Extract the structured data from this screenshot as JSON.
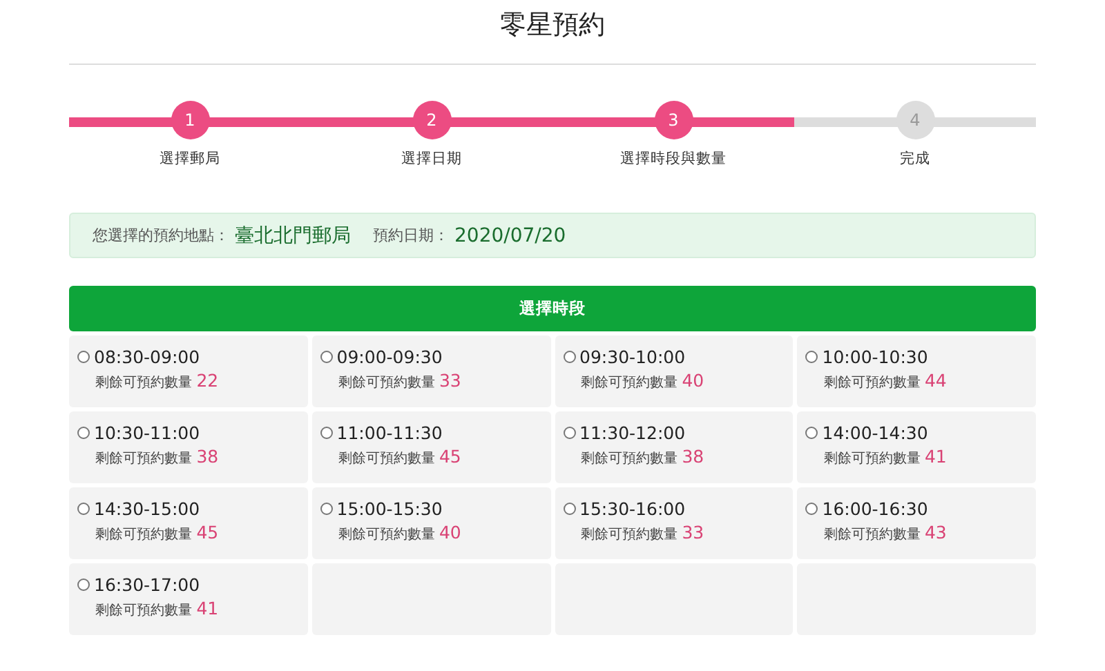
{
  "title": "零星預約",
  "steps": [
    {
      "number": "1",
      "label": "選擇郵局",
      "done": true
    },
    {
      "number": "2",
      "label": "選擇日期",
      "done": true
    },
    {
      "number": "3",
      "label": "選擇時段與數量",
      "done": true
    },
    {
      "number": "4",
      "label": "完成",
      "done": false
    }
  ],
  "summary": {
    "location_label": "您選擇的預約地點：",
    "location": "臺北北門郵局",
    "date_label": "預約日期：",
    "date": "2020/07/20"
  },
  "slots_header": "選擇時段",
  "slots": [
    {
      "time": "08:30-09:00",
      "label": "剩餘可預約數量",
      "count": "22",
      "selected": false
    },
    {
      "time": "09:00-09:30",
      "label": "剩餘可預約數量",
      "count": "33",
      "selected": false
    },
    {
      "time": "09:30-10:00",
      "label": "剩餘可預約數量",
      "count": "40",
      "selected": false
    },
    {
      "time": "10:00-10:30",
      "label": "剩餘可預約數量",
      "count": "44",
      "selected": false
    },
    {
      "time": "10:30-11:00",
      "label": "剩餘可預約數量",
      "count": "38",
      "selected": false
    },
    {
      "time": "11:00-11:30",
      "label": "剩餘可預約數量",
      "count": "45",
      "selected": false
    },
    {
      "time": "11:30-12:00",
      "label": "剩餘可預約數量",
      "count": "38",
      "selected": false
    },
    {
      "time": "14:00-14:30",
      "label": "剩餘可預約數量",
      "count": "41",
      "selected": false
    },
    {
      "time": "14:30-15:00",
      "label": "剩餘可預約數量",
      "count": "45",
      "selected": false
    },
    {
      "time": "15:00-15:30",
      "label": "剩餘可預約數量",
      "count": "40",
      "selected": false
    },
    {
      "time": "15:30-16:00",
      "label": "剩餘可預約數量",
      "count": "33",
      "selected": false
    },
    {
      "time": "16:00-16:30",
      "label": "剩餘可預約數量",
      "count": "43",
      "selected": false
    },
    {
      "time": "16:30-17:00",
      "label": "剩餘可預約數量",
      "count": "41",
      "selected": false
    }
  ]
}
